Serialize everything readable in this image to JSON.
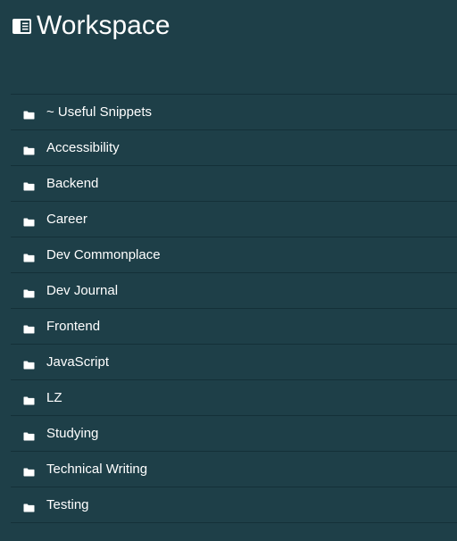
{
  "header": {
    "title": "Workspace",
    "icon": "sidebar-notebook-icon"
  },
  "folders": [
    {
      "label": "~ Useful Snippets",
      "icon": "folder-icon"
    },
    {
      "label": "Accessibility",
      "icon": "folder-icon"
    },
    {
      "label": "Backend",
      "icon": "folder-icon"
    },
    {
      "label": "Career",
      "icon": "folder-icon"
    },
    {
      "label": "Dev Commonplace",
      "icon": "folder-icon"
    },
    {
      "label": "Dev Journal",
      "icon": "folder-icon"
    },
    {
      "label": "Frontend",
      "icon": "folder-icon"
    },
    {
      "label": "JavaScript",
      "icon": "folder-icon"
    },
    {
      "label": "LZ",
      "icon": "folder-icon"
    },
    {
      "label": "Studying",
      "icon": "folder-icon"
    },
    {
      "label": "Technical Writing",
      "icon": "folder-icon"
    },
    {
      "label": "Testing",
      "icon": "folder-icon"
    }
  ],
  "colors": {
    "background": "#1e3f48",
    "divider": "#143038",
    "text": "#ffffff"
  }
}
